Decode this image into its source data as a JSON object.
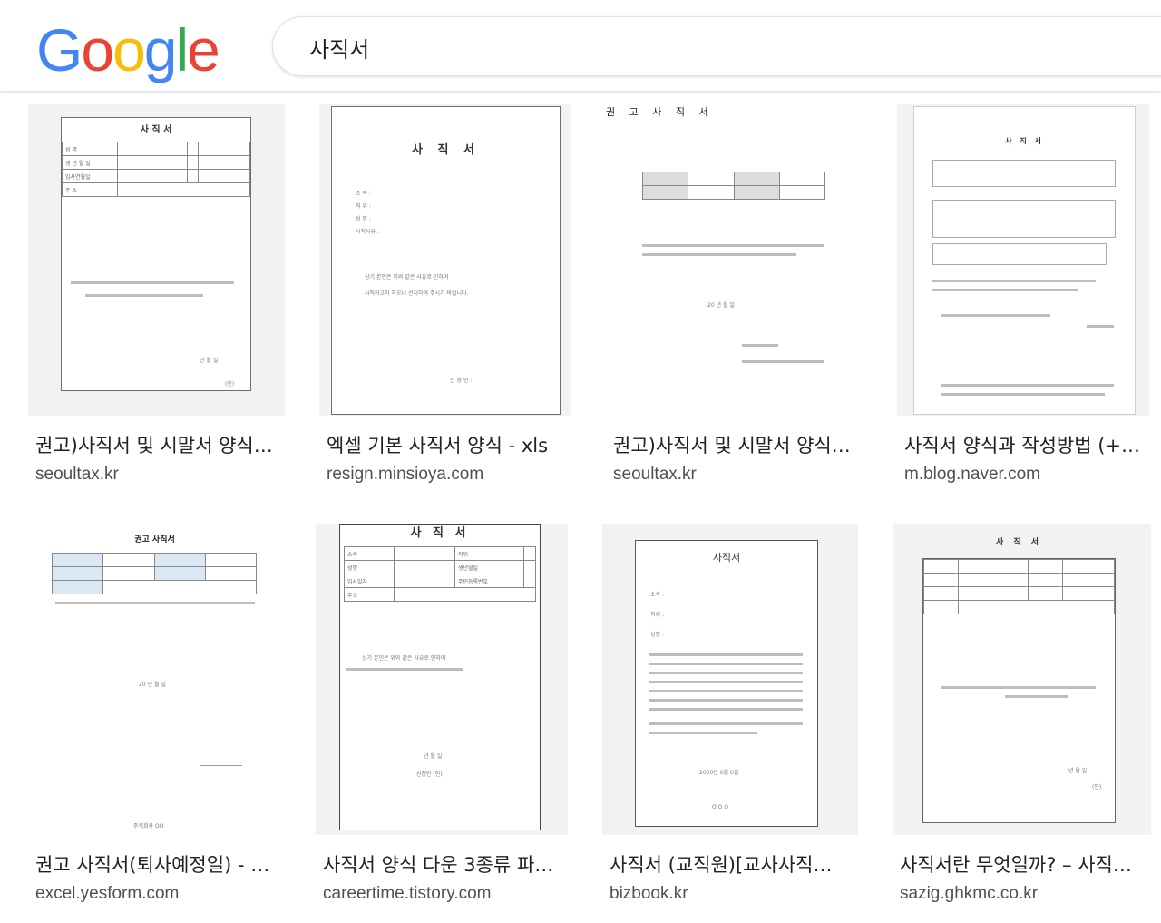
{
  "header": {
    "logo_letters": [
      {
        "ch": "G",
        "color": "#4285F4"
      },
      {
        "ch": "o",
        "color": "#EA4335"
      },
      {
        "ch": "o",
        "color": "#FBBC05"
      },
      {
        "ch": "g",
        "color": "#4285F4"
      },
      {
        "ch": "l",
        "color": "#34A853"
      },
      {
        "ch": "e",
        "color": "#EA4335"
      }
    ],
    "search_query": "사직서"
  },
  "results": [
    {
      "title": "권고)사직서 및 시말서 양식…",
      "site": "seoultax.kr"
    },
    {
      "title": "엑셀 기본 사직서 양식 - xls",
      "site": "resign.minsioya.com"
    },
    {
      "title": "권고)사직서 및 시말서 양식…",
      "site": "seoultax.kr"
    },
    {
      "title": "사직서 양식과 작성방법 (+…",
      "site": "m.blog.naver.com"
    },
    {
      "title": "권고 사직서(퇴사예정일) - …",
      "site": "excel.yesform.com"
    },
    {
      "title": "사직서 양식 다운 3종류 파…",
      "site": "careertime.tistory.com"
    },
    {
      "title": "사직서 (교직원)[교사사직…",
      "site": "bizbook.kr"
    },
    {
      "title": "사직서란 무엇일까? – 사직…",
      "site": "sazig.ghkmc.co.kr"
    }
  ],
  "thumbnails": {
    "t1": {
      "title": "사 직 서",
      "rows": [
        "성 명",
        "생 년 월 일",
        "입사연월일",
        "주 소"
      ],
      "date": "년 월 일",
      "sign": "(인)"
    },
    "t2": {
      "title": "사 직 서",
      "fields": [
        "소 속 :",
        "직 위 :",
        "성 명 :",
        "사직사유 :"
      ],
      "body1": "상기 본인은 위와 같은 사유로 인하여",
      "body2": "사직하고자 하오니 선처하여 주시기 바랍니다.",
      "sign": "신 청 인 :"
    },
    "t3": {
      "title": "권 고 사 직 서",
      "date": "20 년 월 일"
    },
    "t4": {
      "title": "사 직 서"
    },
    "t5": {
      "title": "권고 사직서",
      "company": "주식회사 OO",
      "date": "20 년 월 일"
    },
    "t6": {
      "title": "사 직 서",
      "rows": [
        "소속",
        "성명",
        "입사일자",
        "주소"
      ],
      "right": [
        "직위",
        "생년월일",
        "주민등록번호"
      ],
      "body": "상기 본인은 위와 같은 사유로 인하여",
      "date": "년 월 일",
      "sign": "신청인 (인)"
    },
    "t7": {
      "title": "사직서",
      "fields": [
        "소속 :",
        "직위 :",
        "성명 :"
      ],
      "date": "2000년 0월 0일",
      "footer": "O O O"
    },
    "t8": {
      "title": "사 직 서",
      "date": "년 월 일",
      "sign": "(인)"
    }
  }
}
